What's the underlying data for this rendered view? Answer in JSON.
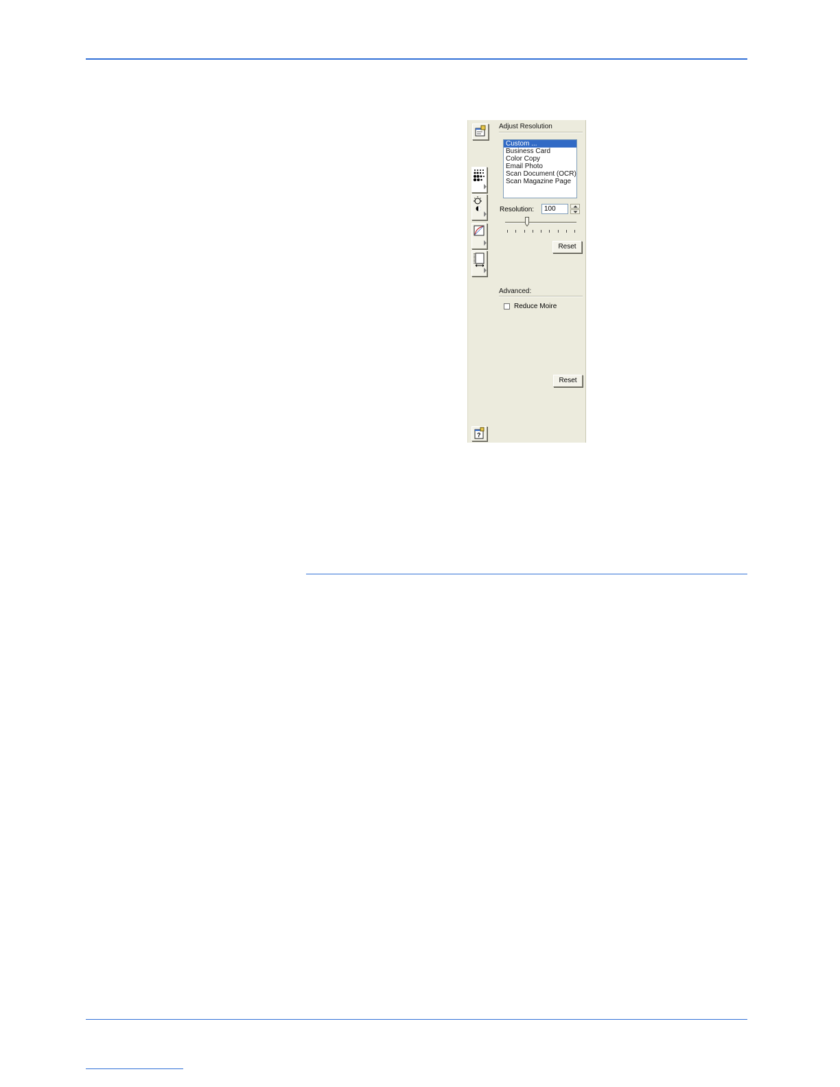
{
  "panel": {
    "adjust_resolution": {
      "title": "Adjust Resolution",
      "presets": [
        "Custom ...",
        "Business Card",
        "Color Copy",
        "Email Photo",
        "Scan Document (OCR)",
        "Scan Magazine Page"
      ],
      "selected": "Custom ..."
    },
    "resolution": {
      "label": "Resolution:",
      "value": "100",
      "slider_position_fraction": 0.3
    },
    "reset_label": "Reset",
    "advanced": {
      "title": "Advanced:",
      "reduce_moire_label": "Reduce Moire",
      "reduce_moire_checked": false
    },
    "reset2_label": "Reset"
  },
  "colors": {
    "rule_blue": "#2f6fd6",
    "panel_bg": "#ecebdd",
    "selection": "#316ac5"
  },
  "icons": [
    "settings-icon",
    "resolution-dots-icon",
    "brightness-icon",
    "gamma-curve-icon",
    "size-crop-icon",
    "help-icon"
  ]
}
